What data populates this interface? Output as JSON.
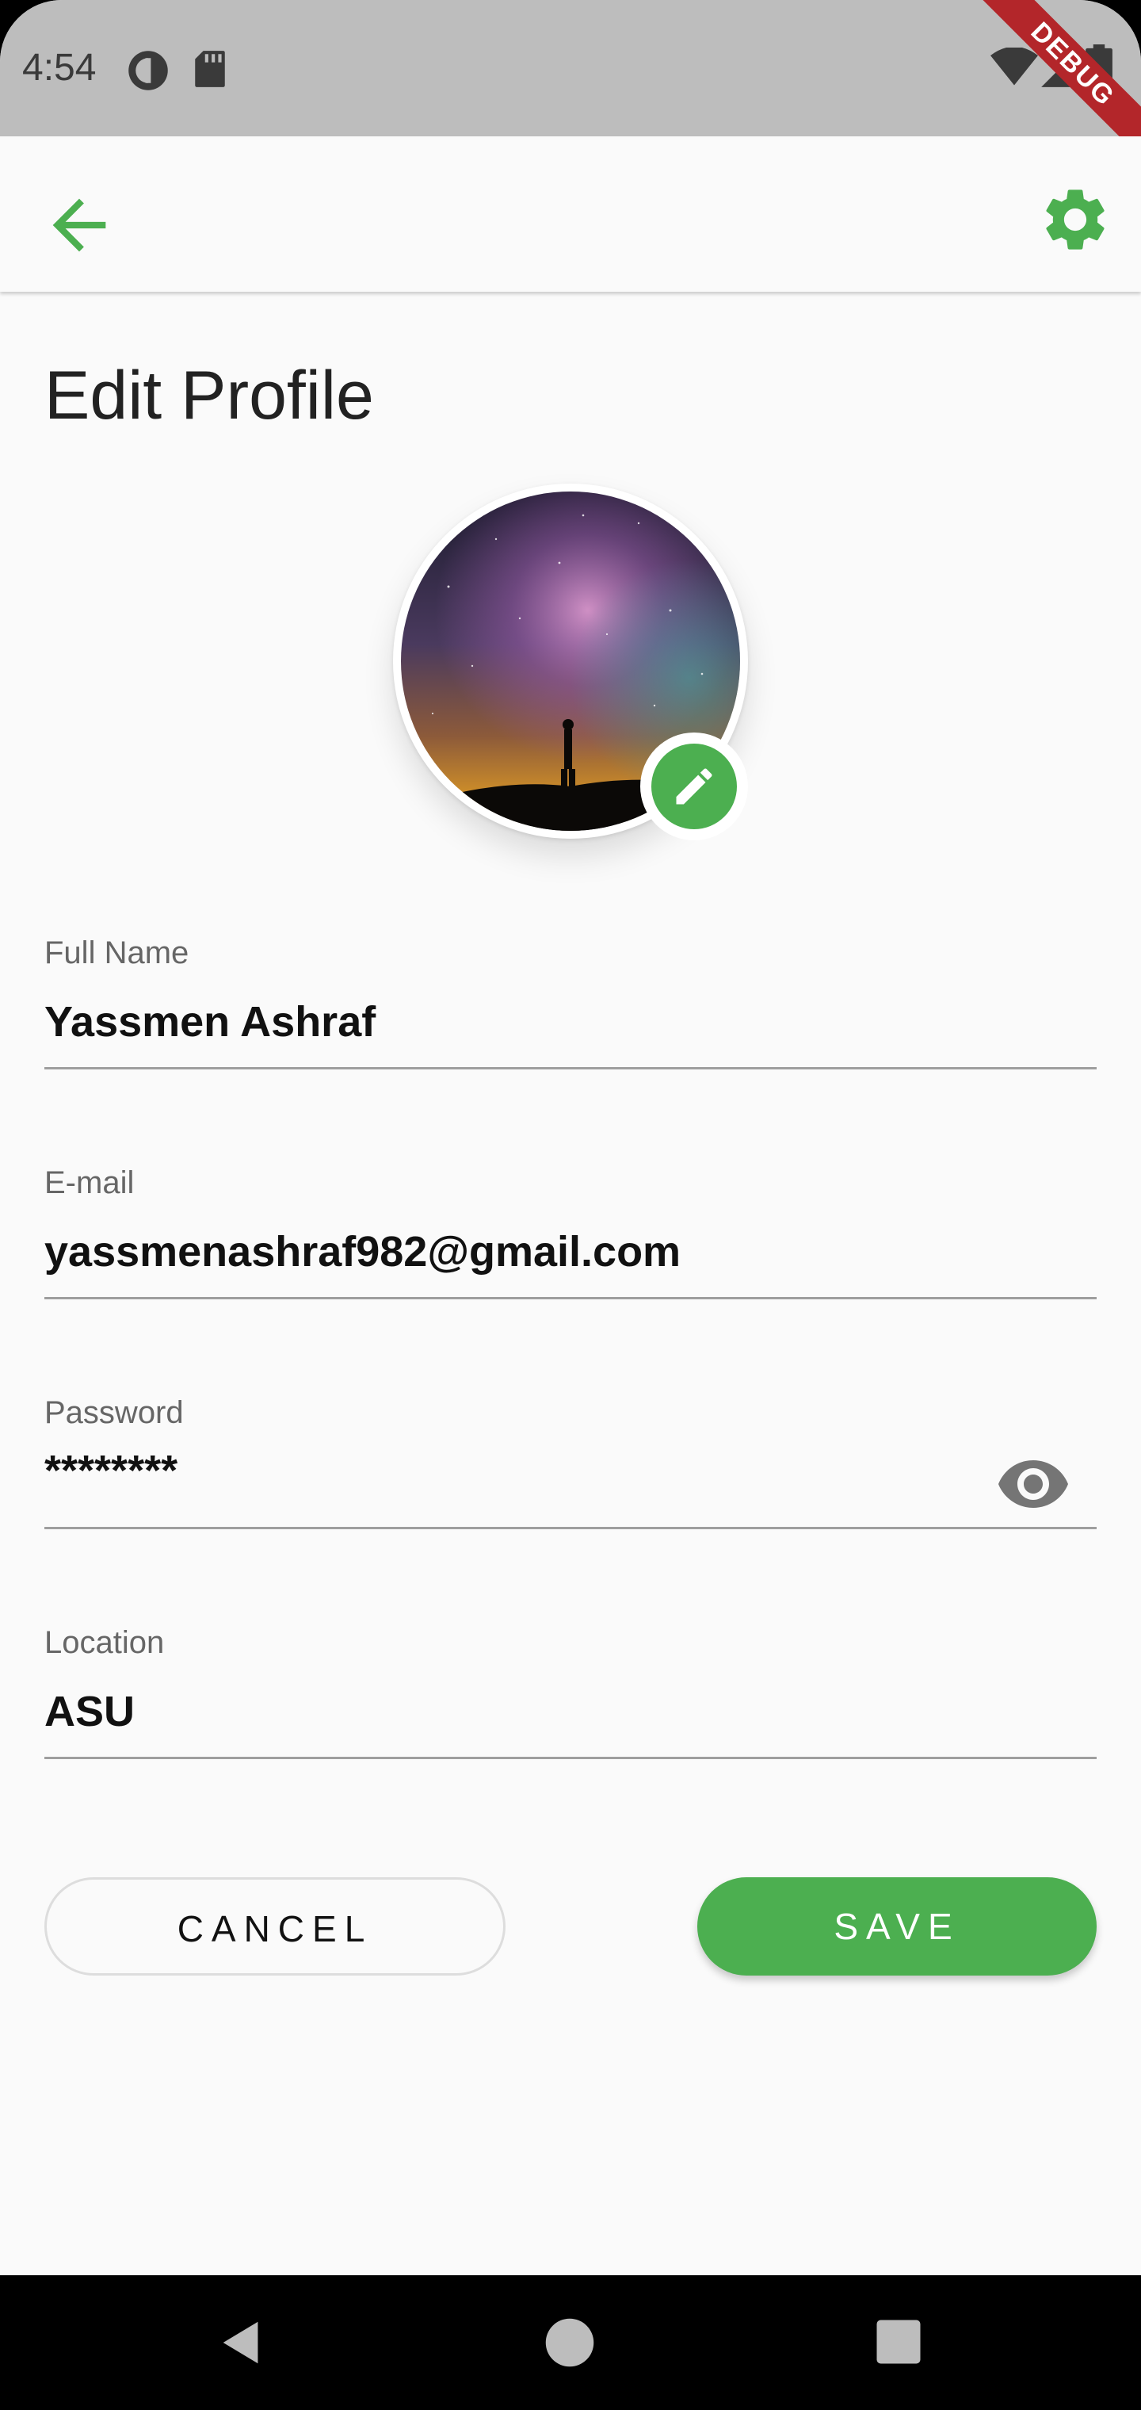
{
  "status_bar": {
    "time": "4:54",
    "icons": [
      "notification-icon",
      "sd-card-icon",
      "wifi-icon",
      "signal-icon",
      "battery-icon"
    ]
  },
  "debug_banner": "DEBUG",
  "app_bar": {
    "back_icon": "arrow-left-icon",
    "settings_icon": "gear-icon",
    "accent_color": "#4caf50"
  },
  "page": {
    "title": "Edit Profile"
  },
  "avatar": {
    "edit_icon": "pencil-icon"
  },
  "form": {
    "full_name": {
      "label": "Full Name",
      "value": "Yassmen Ashraf"
    },
    "email": {
      "label": "E-mail",
      "value": "yassmenashraf982@gmail.com"
    },
    "password": {
      "label": "Password",
      "value": "********",
      "toggle_icon": "eye-icon"
    },
    "location": {
      "label": "Location",
      "value": "ASU"
    }
  },
  "actions": {
    "cancel_label": "CANCEL",
    "save_label": "SAVE"
  },
  "nav_bar": {
    "icons": [
      "back-triangle-icon",
      "home-circle-icon",
      "recents-square-icon"
    ]
  }
}
